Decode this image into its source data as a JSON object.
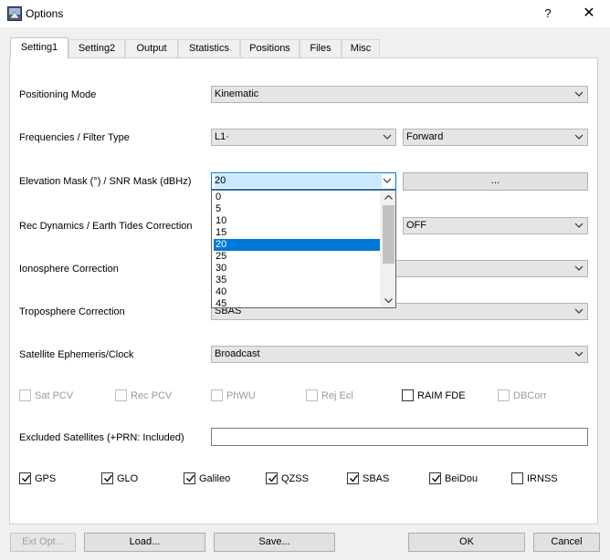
{
  "window": {
    "title": "Options",
    "help": "?",
    "close": "✕"
  },
  "tabs": [
    "Setting1",
    "Setting2",
    "Output",
    "Statistics",
    "Positions",
    "Files",
    "Misc"
  ],
  "rows": {
    "positioning_mode": {
      "label": "Positioning Mode",
      "value": "Kinematic"
    },
    "frequencies": {
      "label": "Frequencies / Filter Type",
      "freq_value": "L1·",
      "filter_value": "Forward"
    },
    "elevation": {
      "label": "Elevation Mask (°) / SNR Mask (dBHz)",
      "value": "20",
      "snr_button": "..."
    },
    "rec_dynamics": {
      "label": "Rec Dynamics / Earth Tides Correction",
      "earth_tides_value": "OFF"
    },
    "ionosphere": {
      "label": "Ionosphere Correction"
    },
    "troposphere": {
      "label": "Troposphere Correction",
      "value": "SBAS"
    },
    "ephemeris": {
      "label": "Satellite Ephemeris/Clock",
      "value": "Broadcast"
    },
    "excluded": {
      "label": "Excluded Satellites (+PRN: Included)",
      "value": ""
    }
  },
  "elevation_options": [
    "0",
    "5",
    "10",
    "15",
    "20",
    "25",
    "30",
    "35",
    "40",
    "45"
  ],
  "elevation_selected": "20",
  "options_checks": [
    {
      "label": "Sat PCV",
      "checked": false,
      "enabled": false
    },
    {
      "label": "Rec PCV",
      "checked": false,
      "enabled": false
    },
    {
      "label": "PhWU",
      "checked": false,
      "enabled": false
    },
    {
      "label": "Rej Ecl",
      "checked": false,
      "enabled": false
    },
    {
      "label": "RAIM FDE",
      "checked": false,
      "enabled": true
    },
    {
      "label": "DBCorr",
      "checked": false,
      "enabled": false
    }
  ],
  "systems": [
    {
      "label": "GPS",
      "checked": true
    },
    {
      "label": "GLO",
      "checked": true
    },
    {
      "label": "Galileo",
      "checked": true
    },
    {
      "label": "QZSS",
      "checked": true
    },
    {
      "label": "SBAS",
      "checked": true
    },
    {
      "label": "BeiDou",
      "checked": true
    },
    {
      "label": "IRNSS",
      "checked": false
    }
  ],
  "buttons": {
    "ext_opt": "Ext Opt...",
    "load": "Load...",
    "save": "Save...",
    "ok": "OK",
    "cancel": "Cancel"
  }
}
